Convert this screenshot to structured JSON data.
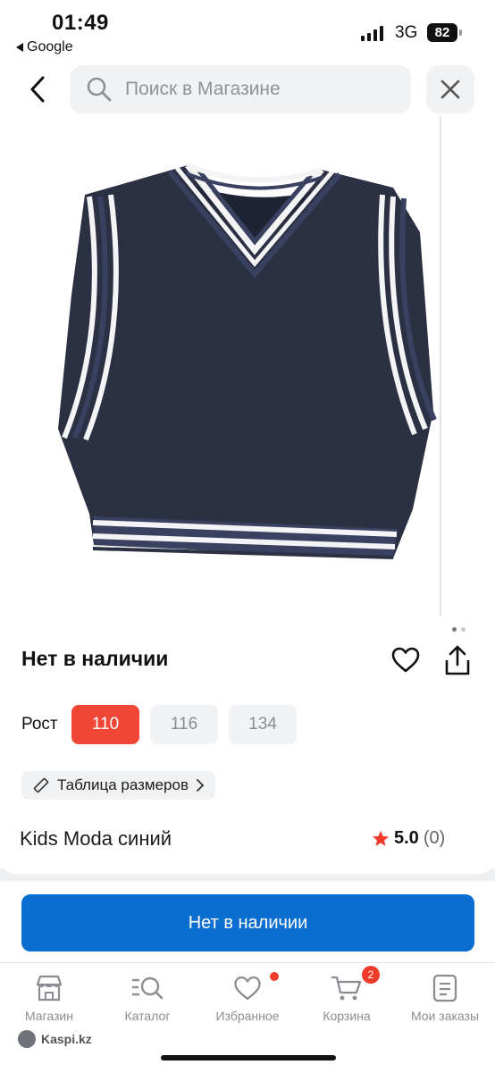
{
  "status_bar": {
    "time": "01:49",
    "back_app": "Google",
    "network": "3G",
    "battery": "82"
  },
  "search": {
    "placeholder": "Поиск в Магазине"
  },
  "product": {
    "availability": "Нет в наличии",
    "size_label": "Рост",
    "sizes": [
      "110",
      "116",
      "134"
    ],
    "selected_size": "110",
    "size_table_label": "Таблица размеров",
    "title": "Kids Moda синий",
    "rating": "5.0",
    "reviews": "(0)",
    "image_dots": 2,
    "active_dot": 0
  },
  "action": {
    "button_label": "Нет в наличии"
  },
  "tabbar": {
    "items": [
      {
        "label": "Магазин",
        "icon": "store-icon"
      },
      {
        "label": "Каталог",
        "icon": "catalog-icon"
      },
      {
        "label": "Избранное",
        "icon": "heart-icon"
      },
      {
        "label": "Корзина",
        "icon": "cart-icon",
        "badge": "2"
      },
      {
        "label": "Мои заказы",
        "icon": "orders-icon"
      }
    ]
  },
  "footer": {
    "brand": "Kaspi.kz"
  },
  "colors": {
    "accent_blue": "#0b6fd1",
    "selected_red": "#f14635",
    "vest_navy": "#2b3143"
  }
}
